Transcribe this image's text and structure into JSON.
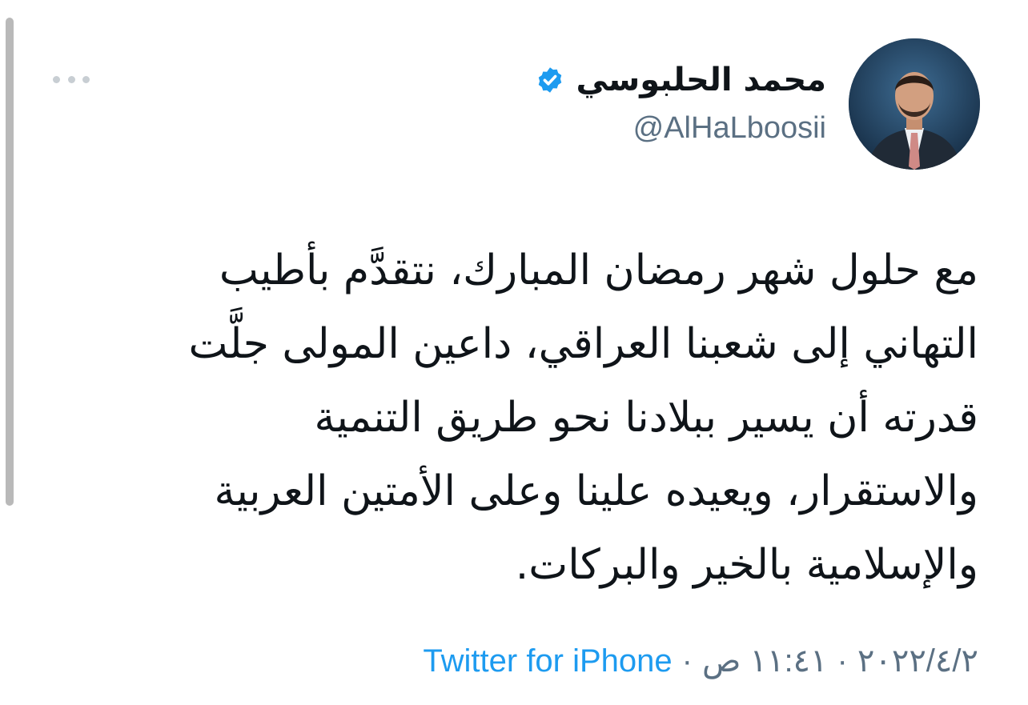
{
  "tweet": {
    "author_name": "محمد الحلبوسي",
    "handle": "@AlHaLboosii",
    "verified_icon": "verified-badge-icon",
    "text": "مع حلول شهر رمضان المبارك، نتقدَّم بأطيب\nالتهاني إلى شعبنا العراقي، داعين المولى جلَّت\nقدرته أن يسير ببلادنا نحو طريق التنمية\nوالاستقرار، ويعيده علينا وعلى الأمتين العربية\nوالإسلامية بالخير والبركات.",
    "date": "٢٠٢٢/٤/٢",
    "time": "١١:٤١ ص",
    "separator": "·",
    "source": "Twitter for iPhone"
  },
  "colors": {
    "accent": "#1d9bf0",
    "secondary_text": "#5b7083",
    "primary_text": "#0f1419"
  },
  "icons": {
    "more": "more-horizontal-icon"
  }
}
